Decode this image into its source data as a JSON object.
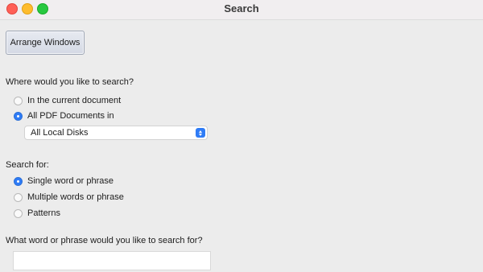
{
  "window": {
    "title": "Search"
  },
  "toolbar": {
    "arrange_label": "Arrange Windows"
  },
  "search_scope": {
    "heading": "Where would you like to search?",
    "options": [
      {
        "label": "In the current document",
        "selected": false
      },
      {
        "label": "All PDF Documents in",
        "selected": true
      }
    ],
    "location_select": {
      "value": "All Local Disks"
    }
  },
  "search_for": {
    "heading": "Search for:",
    "options": [
      {
        "label": "Single word or phrase",
        "selected": true
      },
      {
        "label": "Multiple words or phrase",
        "selected": false
      },
      {
        "label": "Patterns",
        "selected": false
      }
    ]
  },
  "query": {
    "heading": "What word or phrase would you like to search for?",
    "value": ""
  },
  "colors": {
    "accent": "#2f7cf6",
    "close": "#ff5f57",
    "minimize": "#febc2e",
    "maximize": "#28c840"
  }
}
